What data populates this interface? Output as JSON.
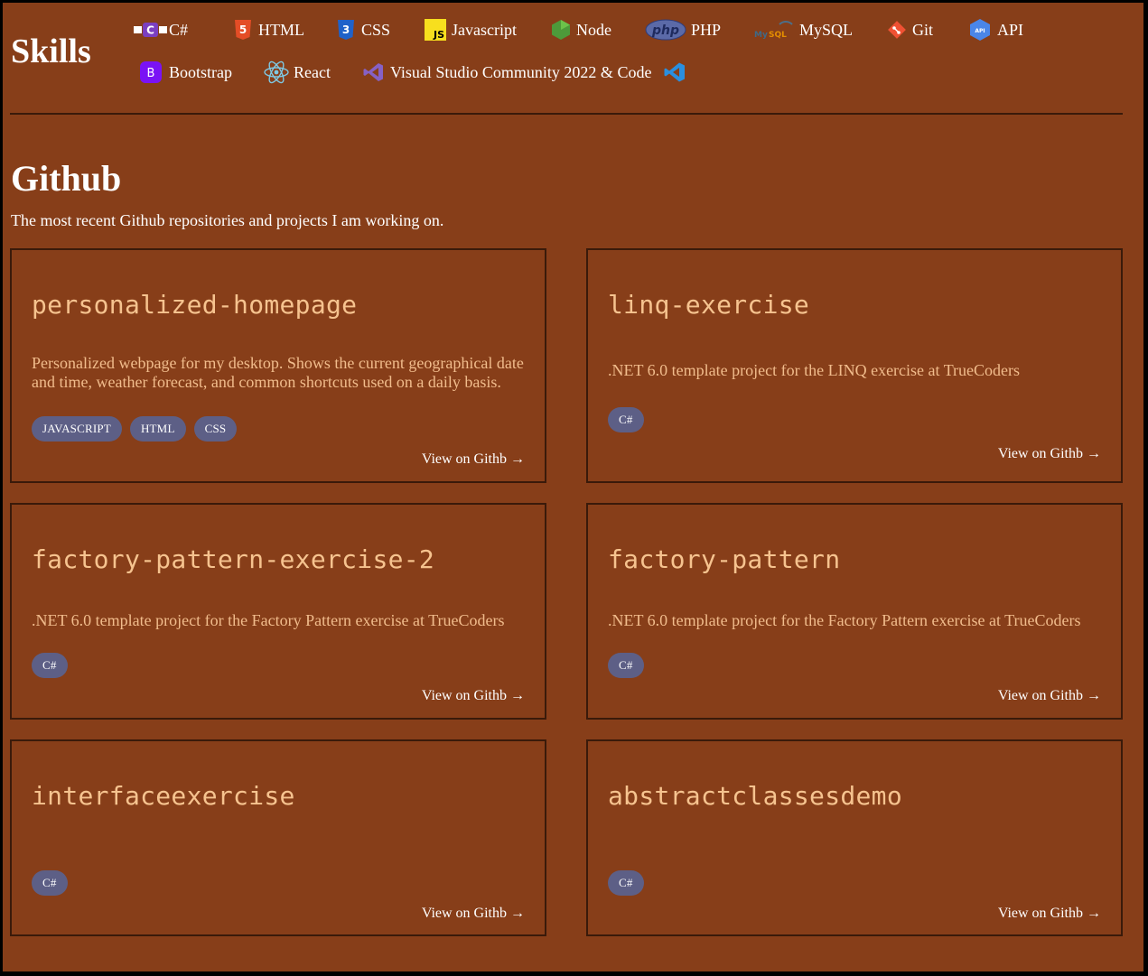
{
  "skills": {
    "title": "Skills",
    "row1": [
      {
        "label": "C#",
        "icon": "csharp-icon"
      },
      {
        "label": "HTML",
        "icon": "html5-icon"
      },
      {
        "label": "CSS",
        "icon": "css3-icon"
      },
      {
        "label": "Javascript",
        "icon": "javascript-icon"
      },
      {
        "label": "Node",
        "icon": "nodejs-icon"
      },
      {
        "label": "PHP",
        "icon": "php-icon"
      },
      {
        "label": "MySQL",
        "icon": "mysql-icon"
      },
      {
        "label": "Git",
        "icon": "git-icon"
      },
      {
        "label": "API",
        "icon": "api-icon"
      }
    ],
    "row2": [
      {
        "label": "Bootstrap",
        "icon": "bootstrap-icon"
      },
      {
        "label": "React",
        "icon": "react-icon"
      },
      {
        "label": "Visual Studio Community 2022 & Code",
        "icon": "visual-studio-icon"
      }
    ]
  },
  "github": {
    "title": "Github",
    "subtitle": "The most recent Github repositories and projects I am working on.",
    "cards": [
      {
        "name": "personalized-homepage",
        "description": "Personalized webpage for my desktop. Shows the current geographical date and time, weather forecast, and common shortcuts used on a daily basis.",
        "tags": [
          "JAVASCRIPT",
          "HTML",
          "CSS"
        ],
        "link": "View on Githb →"
      },
      {
        "name": "linq-exercise",
        "description": ".NET 6.0 template project for the LINQ exercise at TrueCoders",
        "tags": [
          "C#"
        ],
        "link": "View on Githb →"
      },
      {
        "name": "factory-pattern-exercise-2",
        "description": ".NET 6.0 template project for the Factory Pattern exercise at TrueCoders",
        "tags": [
          "C#"
        ],
        "link": "View on Githb →"
      },
      {
        "name": "factory-pattern",
        "description": ".NET 6.0 template project for the Factory Pattern exercise at TrueCoders",
        "tags": [
          "C#"
        ],
        "link": "View on Githb →"
      },
      {
        "name": "interfaceexercise",
        "description": "",
        "tags": [
          "C#"
        ],
        "link": "View on Githb →"
      },
      {
        "name": "abstractclassesdemo",
        "description": "",
        "tags": [
          "C#"
        ],
        "link": "View on Githb →"
      }
    ]
  },
  "colors": {
    "background": "#873e19",
    "repo_name": "#f6c38f",
    "tag": "#5d5f86",
    "border": "#3a1a0a"
  }
}
